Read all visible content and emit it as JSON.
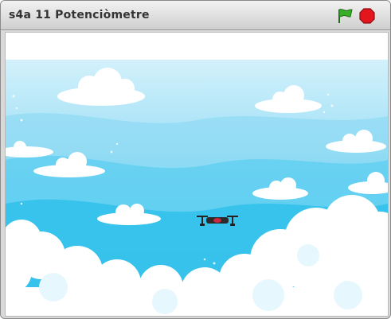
{
  "window": {
    "title": "s4a 11 Potenciòmetre"
  },
  "controls": {
    "green_flag_icon": "green-flag-icon",
    "stop_icon": "stop-sign-icon",
    "flag_color": "#37b028",
    "stop_color": "#e3161d"
  },
  "stage": {
    "backdrop": "sky-with-clouds",
    "sprite": "drone",
    "sky_top": "#d3f1fb",
    "sky_bottom": "#00b4e6"
  }
}
